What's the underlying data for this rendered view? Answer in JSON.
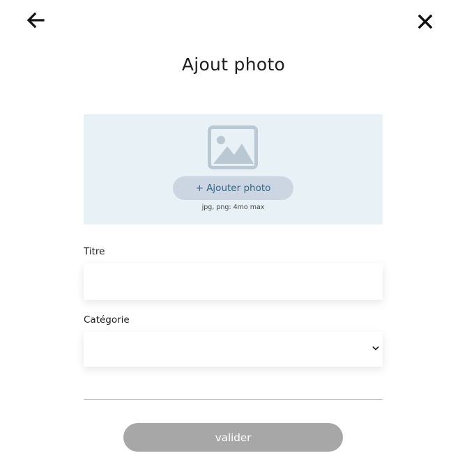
{
  "header": {
    "title": "Ajout photo",
    "back_icon": "arrow-left-icon",
    "close_icon": "close-icon"
  },
  "upload": {
    "icon": "image-placeholder-icon",
    "button_label": "+ Ajouter photo",
    "hint": "jpg, png: 4mo max"
  },
  "form": {
    "title_label": "Titre",
    "title_value": "",
    "category_label": "Catégorie",
    "category_value": "",
    "category_icon": "chevron-down-icon"
  },
  "footer": {
    "submit_label": "valider"
  },
  "colors": {
    "upload_background": "#e8f1f6",
    "upload_button_background": "#cbd6e2",
    "upload_button_text": "#306685",
    "submit_background": "#a7a7a7",
    "divider": "#b3b3b3"
  }
}
